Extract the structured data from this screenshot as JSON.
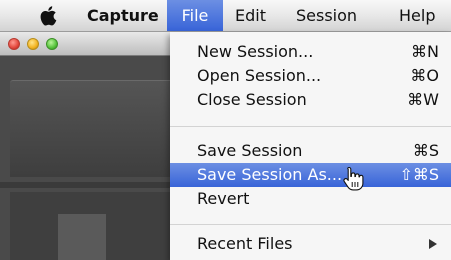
{
  "menubar": {
    "apple_icon": "apple-logo-icon",
    "app_name": "Capture",
    "menus": [
      "File",
      "Edit",
      "Session",
      "Help"
    ]
  },
  "window": {
    "traffic_lights": [
      "close",
      "minimize",
      "zoom"
    ]
  },
  "file_menu": {
    "items": [
      {
        "label": "New Session...",
        "shortcut": "⌘N"
      },
      {
        "label": "Open Session...",
        "shortcut": "⌘O"
      },
      {
        "label": "Close Session",
        "shortcut": "⌘W"
      },
      {
        "label": "Save Session",
        "shortcut": "⌘S"
      },
      {
        "label": "Save Session As...",
        "shortcut": "⇧⌘S",
        "highlighted": true
      },
      {
        "label": "Revert",
        "shortcut": ""
      },
      {
        "label": "Recent Files",
        "submenu_icon": "chevron-right-icon"
      }
    ]
  },
  "colors": {
    "highlight": "#3864d8",
    "menubar": "#e6e6e6"
  },
  "cursor_icon": "pointing-hand-icon"
}
